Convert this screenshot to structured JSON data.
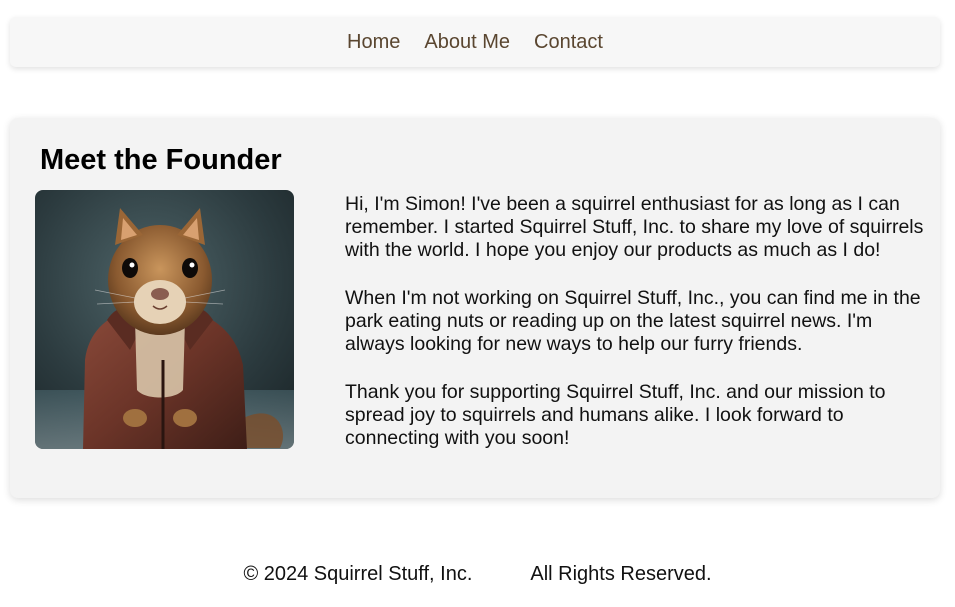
{
  "nav": {
    "items": [
      {
        "label": "Home"
      },
      {
        "label": "About Me"
      },
      {
        "label": "Contact"
      }
    ]
  },
  "founder": {
    "heading": "Meet the Founder",
    "photo_alt": "squirrel-in-jacket",
    "paragraphs": [
      "Hi, I'm Simon! I've been a squirrel enthusiast for as long as I can remember. I started Squirrel Stuff, Inc. to share my love of squirrels with the world. I hope you enjoy our products as much as I do!",
      "When I'm not working on Squirrel Stuff, Inc., you can find me in the park eating nuts or reading up on the latest squirrel news. I'm always looking for new ways to help our furry friends.",
      "Thank you for supporting Squirrel Stuff, Inc. and our mission to spread joy to squirrels and humans alike. I look forward to connecting with you soon!"
    ]
  },
  "footer": {
    "copyright": "© 2024 Squirrel Stuff, Inc.",
    "rights": "All Rights Reserved."
  },
  "colors": {
    "nav_link": "#5a4630",
    "card_bg": "#f3f3f3",
    "nav_bg": "#f7f7f7"
  }
}
